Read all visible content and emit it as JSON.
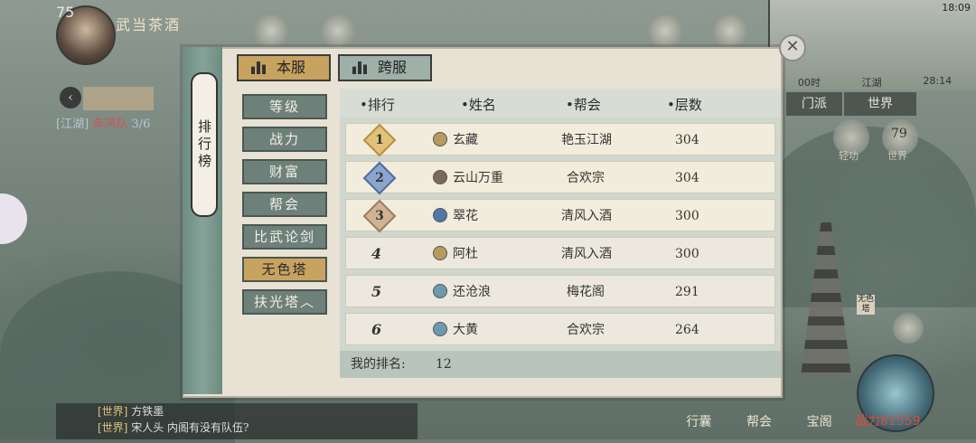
{
  "player": {
    "level": "75",
    "name": "武当茶酒"
  },
  "quest": {
    "channel": "[江湖]",
    "team": "赤鸿队",
    "count": "3/6"
  },
  "status": {
    "time": "18:09"
  },
  "minimap": {
    "left": "00时",
    "mid": "江湖",
    "right": "28:14"
  },
  "channels": [
    "门派",
    "世界"
  ],
  "side_buttons": [
    {
      "label": "轻功"
    },
    {
      "label": "世界",
      "count": "79"
    }
  ],
  "side_tag": "无色塔",
  "bottom_bar": [
    "行囊",
    "帮会",
    "宝阁"
  ],
  "power": "战力81559",
  "chat": [
    {
      "channel": "[世界]",
      "text": "方铁墨"
    },
    {
      "channel": "[世界]",
      "text": "宋人头 内阁有没有队伍?"
    }
  ],
  "panel": {
    "title": "排行榜",
    "server_tabs": [
      "本服",
      "跨服"
    ],
    "categories": [
      "等级",
      "战力",
      "财富",
      "帮会",
      "比武论剑",
      "无色塔",
      "扶光塔︿"
    ],
    "active_category": "无色塔",
    "columns": [
      "排行",
      "姓名",
      "帮会",
      "层数"
    ],
    "rows": [
      {
        "rank": "1",
        "name": "玄藏",
        "guild": "艳玉江湖",
        "floors": "304",
        "sect_color": "#b89a5e"
      },
      {
        "rank": "2",
        "name": "云山万重",
        "guild": "合欢宗",
        "floors": "304",
        "sect_color": "#7a6a5a"
      },
      {
        "rank": "3",
        "name": "翠花",
        "guild": "清风入酒",
        "floors": "300",
        "sect_color": "#4f78a8"
      },
      {
        "rank": "4",
        "name": "阿杜",
        "guild": "清风入酒",
        "floors": "300",
        "sect_color": "#b89a5e"
      },
      {
        "rank": "5",
        "name": "还沧浪",
        "guild": "梅花阁",
        "floors": "291",
        "sect_color": "#6e9ab0"
      },
      {
        "rank": "6",
        "name": "大黄",
        "guild": "合欢宗",
        "floors": "264",
        "sect_color": "#6e9ab0"
      }
    ],
    "my_rank_label": "我的排名:",
    "my_rank_value": "12"
  }
}
